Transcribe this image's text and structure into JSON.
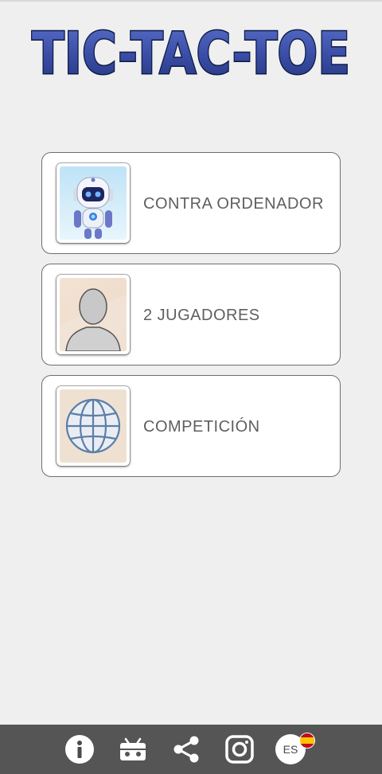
{
  "app": {
    "title": "TIC-TAC-TOE"
  },
  "menu": {
    "items": [
      {
        "label": "CONTRA ORDENADOR",
        "icon": "robot-icon"
      },
      {
        "label": "2 JUGADORES",
        "icon": "person-silhouette-icon"
      },
      {
        "label": "COMPETICIÓN",
        "icon": "globe-icon"
      }
    ]
  },
  "bottom_bar": {
    "info_icon": "info-icon",
    "android_icon": "android-icon",
    "share_icon": "share-icon",
    "instagram_icon": "instagram-icon",
    "language_label": "ES",
    "language_flag": "spain-flag-icon"
  },
  "colors": {
    "title_fill": "#3b4fa8",
    "title_outline": "#0d1b45",
    "background": "#efeff0",
    "bottom_bar": "#555555"
  }
}
